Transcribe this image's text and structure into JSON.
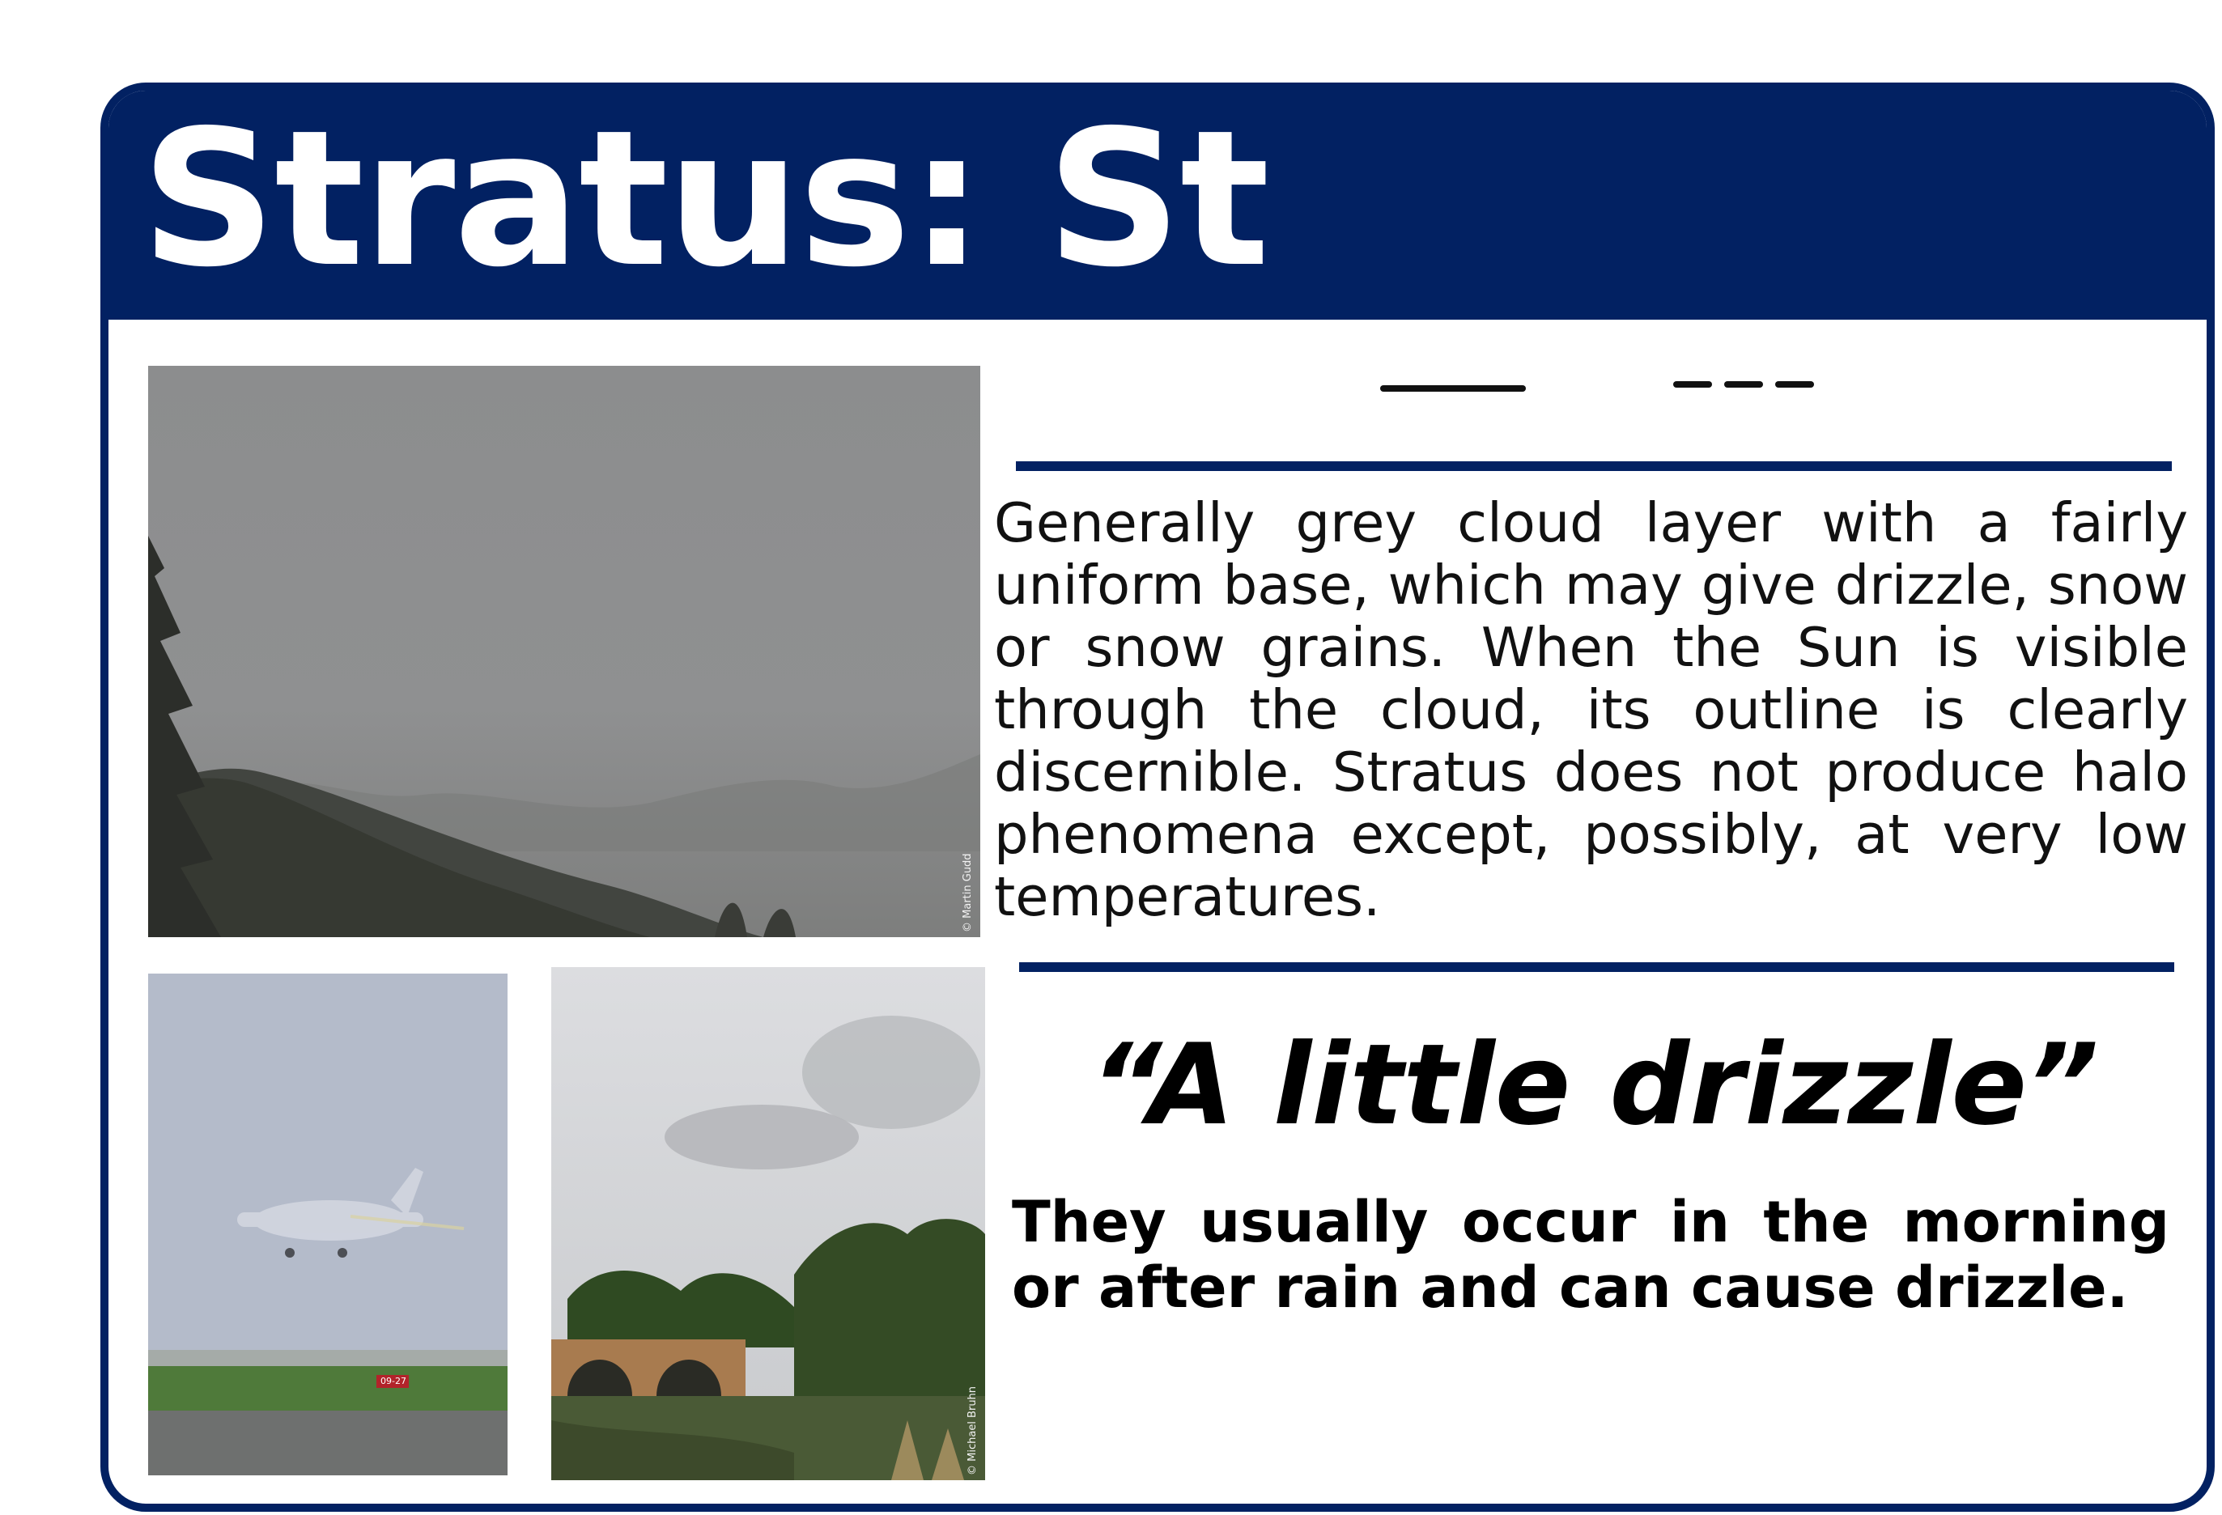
{
  "title": "Stratus: St",
  "description": "Generally grey cloud layer with a fairly uniform base, which may give drizzle, snow or snow grains. When the Sun is visible through the cloud, its outline is clearly discernible. Stratus does not produce halo phenomena except, possibly, at very low temperatures.",
  "quote": "“A little drizzle”",
  "note": "They usually occur in the morning or after rain and can cause drizzle.",
  "photos": {
    "main_credit": "© Martin Gudd",
    "bridge_credit": "© Michael Bruhn",
    "runway_sign": "09-27"
  },
  "symbols": [
    "stratus-solid-line-symbol",
    "stratus-dashed-line-symbol"
  ],
  "colors": {
    "navy": "#022162",
    "white": "#ffffff"
  }
}
